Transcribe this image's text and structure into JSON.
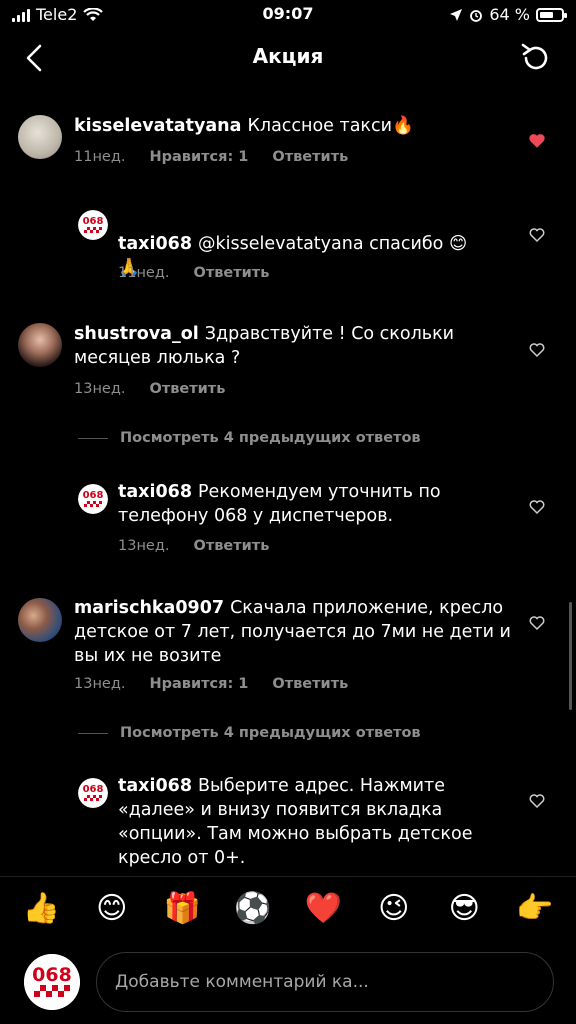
{
  "status_bar": {
    "carrier": "Tele2",
    "time": "09:07",
    "battery": "64 %",
    "battery_level": 0.64
  },
  "header": {
    "title": "Акция",
    "back_icon": "chevron-left-icon",
    "refresh_icon": "refresh-icon"
  },
  "comments": [
    {
      "user": "kisselevatatyana",
      "text": "Классное такси🔥",
      "time": "11нед.",
      "likes": "Нравится: 1",
      "reply": "Ответить",
      "liked": true
    },
    {
      "user": "taxi068",
      "text": "@kisselevatatyana спасибо 😊\n🙏",
      "time": "11нед.",
      "reply": "Ответить",
      "liked": false
    },
    {
      "user": "shustrova_ol",
      "text": "Здравствуйте ! Со скольки месяцев люлька ?",
      "time": "13нед.",
      "reply": "Ответить",
      "liked": false
    },
    {
      "view_more": "Посмотреть 4 предыдущих ответов"
    },
    {
      "user": "taxi068",
      "text": "Рекомендуем уточнить по телефону 068 у диспетчеров.",
      "time": "13нед.",
      "reply": "Ответить",
      "liked": false
    },
    {
      "user": "marischka0907",
      "text": "Скачала приложение, кресло детское от 7 лет,  получается до 7ми не дети и вы их не возите",
      "time": "13нед.",
      "likes": "Нравится: 1",
      "reply": "Ответить",
      "liked": false
    },
    {
      "view_more": "Посмотреть 4 предыдущих ответов"
    },
    {
      "user": "taxi068",
      "text": "Выберите адрес. Нажмите «далее» и внизу появится вкладка «опции». Там можно выбрать детское кресло от 0+.",
      "liked": false
    }
  ],
  "emoji_bar": [
    "👍",
    "😊",
    "🎁",
    "⚽",
    "❤️",
    "😉",
    "😎",
    "👉"
  ],
  "composer": {
    "placeholder": "Добавьте комментарий ка...",
    "logo_text": "068"
  },
  "colors": {
    "background": "#000000",
    "muted_text": "#8e8e8e",
    "like_red": "#ed4956",
    "brand_red": "#d0021b"
  }
}
